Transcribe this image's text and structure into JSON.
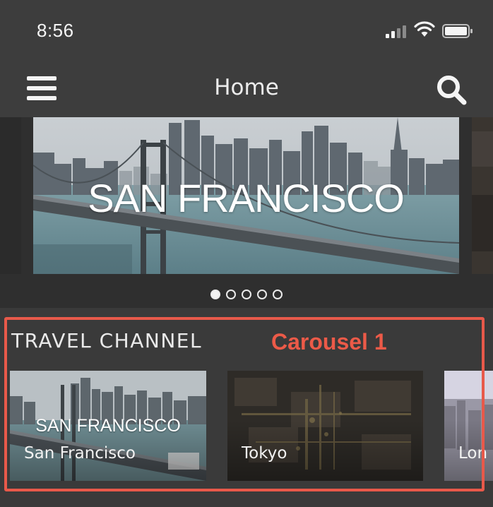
{
  "status_bar": {
    "time": "8:56"
  },
  "nav": {
    "title": "Home"
  },
  "hero": {
    "caption": "SAN FRANCISCO",
    "pagination": {
      "total": 5,
      "active_index": 0
    }
  },
  "section": {
    "title": "TRAVEL CHANNEL",
    "annotation": "Carousel 1",
    "cards": [
      {
        "inner_title": "SAN FRANCISCO",
        "label": "San Francisco"
      },
      {
        "inner_title": "",
        "label": "Tokyo"
      },
      {
        "inner_title": "",
        "label": "Lon"
      }
    ]
  },
  "colors": {
    "background": "#3a3a3a",
    "bar": "#3d3d3d",
    "annotation": "#ec5a48"
  },
  "icons": {
    "menu": "hamburger-menu-icon",
    "search": "magnifier-search-icon",
    "signal": "cellular-signal-icon",
    "wifi": "wifi-icon",
    "battery": "battery-icon"
  }
}
